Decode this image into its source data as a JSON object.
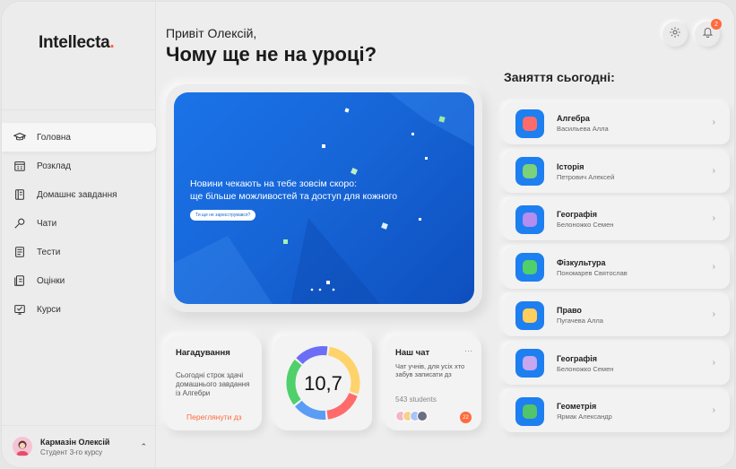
{
  "app": {
    "logo": "Intellecta",
    "logo_dot": ".",
    "accent": "#ff5a3c",
    "primary": "#1a73e8"
  },
  "nav": [
    {
      "label": "Головна",
      "icon": "graduation-cap-icon",
      "active": true
    },
    {
      "label": "Розклад",
      "icon": "calendar-icon"
    },
    {
      "label": "Домашнє завдання",
      "icon": "notebook-icon"
    },
    {
      "label": "Чати",
      "icon": "chat-search-icon"
    },
    {
      "label": "Тести",
      "icon": "test-sheet-icon"
    },
    {
      "label": "Оцінки",
      "icon": "grades-icon"
    },
    {
      "label": "Курси",
      "icon": "courses-icon"
    }
  ],
  "user": {
    "name": "Кармазін Олексій",
    "role": "Студент 3-го курсу"
  },
  "header": {
    "greeting": "Привіт Олексій,",
    "headline": "Чому ще не на уроці?",
    "notifications_count": "2"
  },
  "banner": {
    "line1": "Новини чекають на тебе зовсім скоро:",
    "line2": "ще більше можливостей та доступ для кожного",
    "button": "Ти ще не зареєструвався?"
  },
  "reminder": {
    "title": "Нагадування",
    "text": "Сьогодні строк здачі домашнього завдання із Алгебри",
    "link": "Переглянути дз"
  },
  "grade": {
    "value": "10,7",
    "segments": [
      {
        "color": "#ffd36b",
        "value": 28
      },
      {
        "color": "#ff6b6b",
        "value": 18
      },
      {
        "color": "#5b9cf5",
        "value": 16
      },
      {
        "color": "#4fd06a",
        "value": 22
      },
      {
        "color": "#6c6ef5",
        "value": 16
      }
    ]
  },
  "chat": {
    "title": "Наш чат",
    "more": "···",
    "text": "Чат учнів, для усіх хто забув записати дз",
    "students": "543 students",
    "badge": "22"
  },
  "lessons_title": "Заняття сьогодні:",
  "lessons": [
    {
      "name": "Алгебра",
      "teacher": "Васильева Алла",
      "icon": "#ff6b6b"
    },
    {
      "name": "Історія",
      "teacher": "Петрович Алексей",
      "icon": "#7ad27a"
    },
    {
      "name": "Географія",
      "teacher": "Белоножко Семен",
      "icon": "#b58cf0"
    },
    {
      "name": "Фізкультура",
      "teacher": "Пономарев Святослав",
      "icon": "#4fd06a"
    },
    {
      "name": "Право",
      "teacher": "Пугачева Алла",
      "icon": "#ffce5c"
    },
    {
      "name": "Географія",
      "teacher": "Белоножко Семен",
      "icon": "#c7a6f2"
    },
    {
      "name": "Геометрія",
      "teacher": "Ярмак Александр",
      "icon": "#52c46a"
    }
  ]
}
